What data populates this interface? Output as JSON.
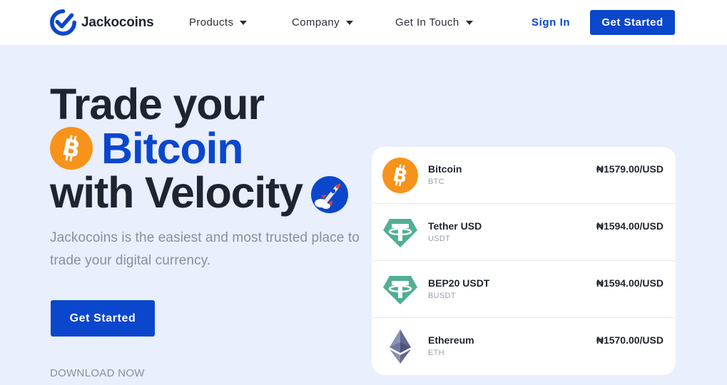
{
  "brand": {
    "name": "Jackocoins",
    "color": "#0b47cc",
    "logo_icon": "jackocoins-check-logo-icon"
  },
  "nav": {
    "items": [
      {
        "label": "Products",
        "icon": "caret-down-icon"
      },
      {
        "label": "Company",
        "icon": "caret-down-icon"
      },
      {
        "label": "Get In Touch",
        "icon": "caret-down-icon"
      }
    ],
    "sign_in": "Sign In",
    "get_started": "Get Started"
  },
  "hero": {
    "line1": "Trade your",
    "line2": "Bitcoin",
    "line3": "with Velocity",
    "line2_icon": "bitcoin-icon",
    "line3_icon": "rocket-icon",
    "subtitle": "Jackocoins is the easiest and most trusted place to trade your digital currency.",
    "cta": "Get Started",
    "download": "DOWNLOAD NOW"
  },
  "rates": [
    {
      "name": "Bitcoin",
      "symbol": "BTC",
      "price": "₦1579.00/USD",
      "icon": "bitcoin-icon"
    },
    {
      "name": "Tether USD",
      "symbol": "USDT",
      "price": "₦1594.00/USD",
      "icon": "tether-icon"
    },
    {
      "name": "BEP20 USDT",
      "symbol": "BUSDT",
      "price": "₦1594.00/USD",
      "icon": "tether-icon"
    },
    {
      "name": "Ethereum",
      "symbol": "ETH",
      "price": "₦1570.00/USD",
      "icon": "ethereum-icon"
    }
  ],
  "colors": {
    "accent": "#0b47cc",
    "background": "#e9effd",
    "bitcoin": "#f7931a",
    "tether": "#50af95",
    "ethereum": "#627eea"
  }
}
